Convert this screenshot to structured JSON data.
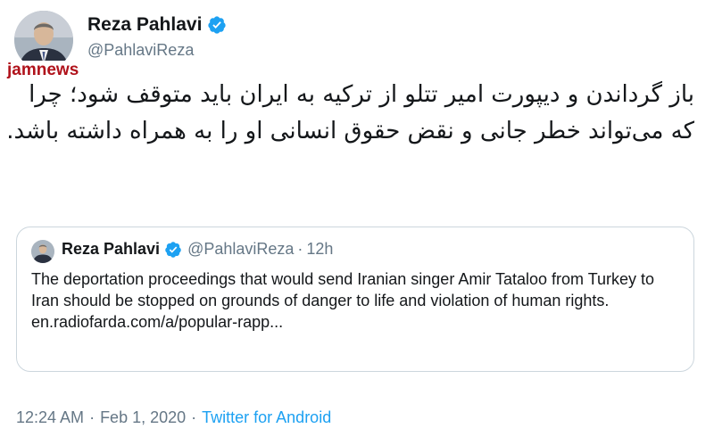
{
  "author": {
    "name": "Reza Pahlavi",
    "handle": "@PahlaviReza",
    "verified_icon": "verified-badge-icon"
  },
  "watermark": "jamnews",
  "tweet": {
    "text": "باز گرداندن و دیپورت امیر تتلو از ترکیه به ایران باید متوقف شود؛ چرا که می‌تواند خطر جانی و نقض حقوق انسانی او را به همراه داشته باشد."
  },
  "quoted": {
    "name": "Reza Pahlavi",
    "handle": "@PahlaviReza",
    "separator": "·",
    "time": "12h",
    "text": "The deportation proceedings that would send Iranian singer Amir Tataloo from Turkey to Iran should be stopped on grounds of danger to life and violation of human rights.",
    "link": "en.radiofarda.com/a/popular-rapp..."
  },
  "meta": {
    "time": "12:24 AM",
    "separator": "·",
    "date": "Feb 1, 2020",
    "source": "Twitter for Android"
  },
  "colors": {
    "verified": "#1da1f2",
    "secondary_text": "#657786",
    "border": "#ccd6dd",
    "watermark": "#b0121b"
  }
}
